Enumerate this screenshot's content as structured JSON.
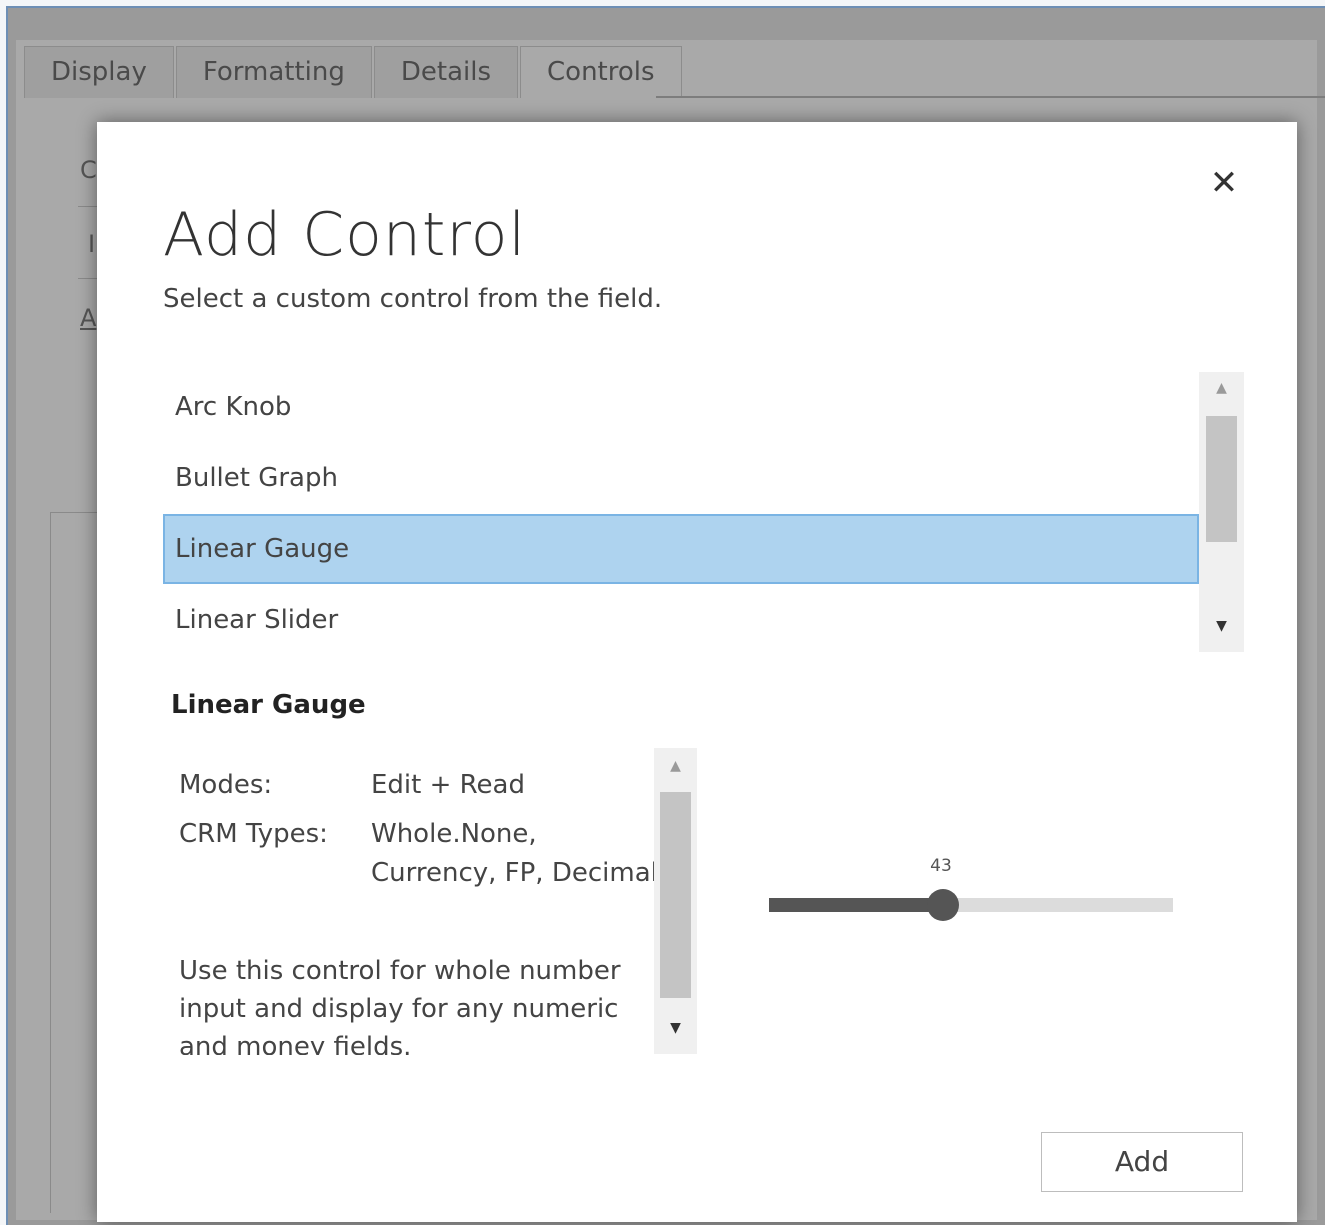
{
  "background": {
    "tabs": [
      {
        "label": "Display"
      },
      {
        "label": "Formatting"
      },
      {
        "label": "Details"
      },
      {
        "label": "Controls"
      }
    ],
    "fragments": [
      "C",
      "I",
      "A"
    ]
  },
  "dialog": {
    "close_icon": "✕",
    "title": "Add Control",
    "subtitle": "Select a custom control from the field.",
    "controls": [
      {
        "label": "Arc Knob",
        "selected": false
      },
      {
        "label": "Bullet Graph",
        "selected": false
      },
      {
        "label": "Linear Gauge",
        "selected": true
      },
      {
        "label": "Linear Slider",
        "selected": false
      }
    ],
    "list_scroll_up": "▲",
    "list_scroll_down": "▼",
    "details": {
      "heading": "Linear Gauge",
      "modes_label": "Modes:",
      "modes_value": "Edit + Read",
      "crm_types_label": "CRM Types:",
      "crm_types_line1": "Whole.None,",
      "crm_types_line2": "Currency, FP, Decimal",
      "description": "Use this control for whole number input and display for any numeric and money fields.",
      "scroll_up": "▲",
      "scroll_down": "▼"
    },
    "preview": {
      "value_label": "43",
      "fill_fraction": 0.43
    },
    "add_label": "Add"
  }
}
